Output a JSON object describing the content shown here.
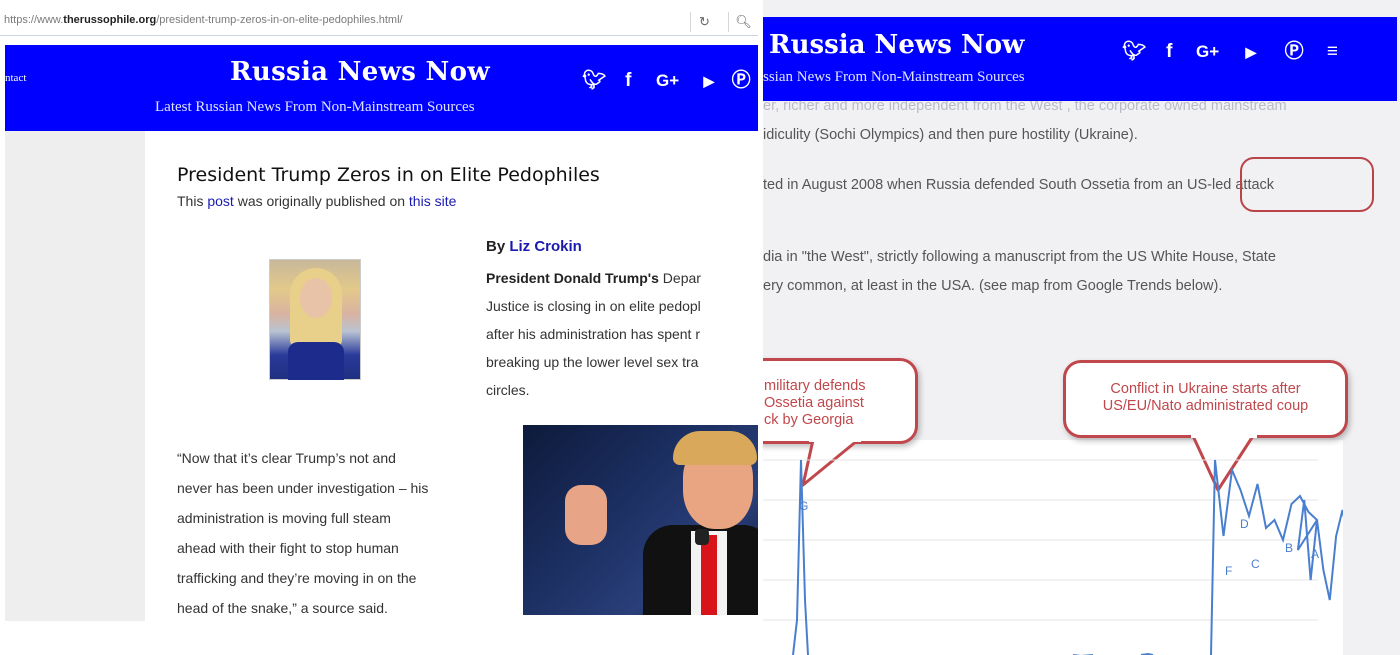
{
  "left": {
    "browser": {
      "url_prefix": "https://www.",
      "url_domain": "therussophile.org",
      "url_path": "/president-trump-zeros-in-on-elite-pedophiles.html/",
      "reload_icon": "reload-icon",
      "search_icon": "search-icon"
    },
    "header": {
      "contact_label": "ntact",
      "site_title": "Russia News Now",
      "tagline": "Latest Russian News From Non-Mainstream Sources",
      "social_icons": [
        "twitter-icon",
        "facebook-icon",
        "google-plus-icon",
        "youtube-icon",
        "pinterest-icon"
      ]
    },
    "article": {
      "title": "President Trump Zeros in on Elite Pedophiles",
      "origin_prefix": "This ",
      "origin_link1": "post",
      "origin_middle": " was originally published on ",
      "origin_link2": "this site",
      "by_prefix": "By ",
      "author": "Liz Crokin",
      "body_bold": "President Donald Trump's",
      "body_lines": [
        " Depar",
        "Justice is closing in on elite pedopl",
        "after his administration has spent r",
        "breaking up the lower level sex tra",
        "circles."
      ],
      "quote_lines": [
        "“Now that it’s clear Trump’s not and",
        "never has been under investigation – his",
        "administration is moving full steam",
        "ahead with their fight to stop human",
        "trafficking and they’re moving in on the",
        "head of the snake,” a source said."
      ]
    }
  },
  "right": {
    "header": {
      "site_title": "Russia News Now",
      "tagline": "ssian News From Non-Mainstream Sources",
      "social_icons": [
        "twitter-icon",
        "facebook-icon",
        "google-plus-icon",
        "youtube-icon",
        "pinterest-icon",
        "rss-icon"
      ]
    },
    "text": {
      "faded_line": "er, richer and more independent from  the West , the corporate owned mainstream",
      "line1": "idiculity (Sochi Olympics) and then pure hostility (Ukraine).",
      "line2_a": "ted in August 2008 when Russia defended South Ossetia from ",
      "line2_b": "an US-led attack",
      "line3": "dia in \"the West\", strictly following a manuscript from the US White House, State",
      "line4": "ery common, at least in the USA. (see map from Google Trends below)."
    },
    "callouts": {
      "left": [
        "military defends",
        "Ossetia against",
        "ck by Georgia"
      ],
      "right": [
        "Conflict in Ukraine starts after",
        "US/EU/Nato administrated coup"
      ]
    },
    "colors": {
      "accent": "#c0474b",
      "header_blue": "#0000ff",
      "line": "#4a7fd0"
    }
  },
  "chart_data": {
    "type": "line",
    "title": "",
    "xlabel": "",
    "ylabel": "",
    "series": [
      {
        "values": [
          100,
          62,
          95,
          85,
          72,
          88,
          66,
          70,
          60,
          78,
          82,
          74,
          70
        ]
      }
    ],
    "markers": [
      "G",
      "F",
      "D",
      "C",
      "B",
      "A"
    ],
    "grid": true
  }
}
